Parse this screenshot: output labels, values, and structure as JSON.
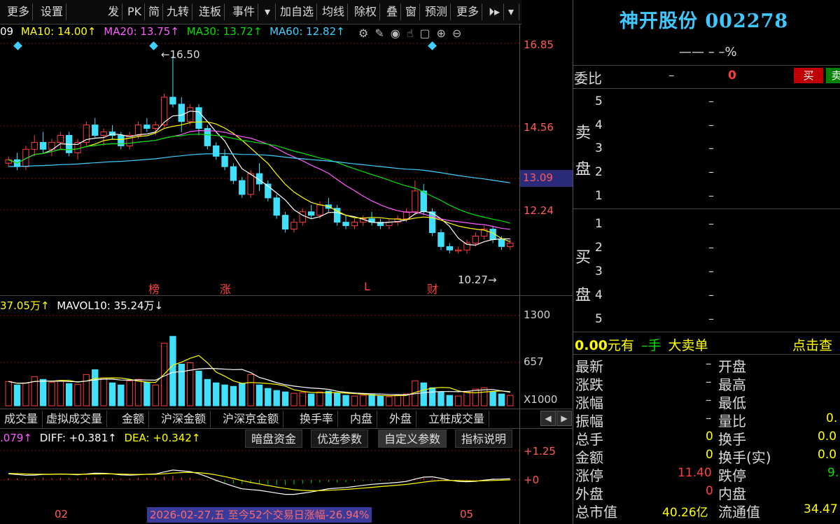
{
  "toolbar": {
    "items": [
      "更多",
      "设置",
      "发",
      "PK",
      "简",
      "九转",
      "连板",
      "事件",
      "▾",
      "加自选",
      "均线",
      "除权",
      "叠",
      "窗",
      "预测",
      "更多",
      "⏵▸",
      "▾"
    ]
  },
  "ma_legend": {
    "ma5": "09",
    "ma10": "MA10: 14.00↑",
    "ma20": "MA20: 13.75↑",
    "ma30": "MA30: 13.72↑",
    "ma60": "MA60: 12.82↑"
  },
  "colors": {
    "ma5": "#ffffff",
    "ma10": "#ffff00",
    "ma20": "#ff5cff",
    "ma30": "#00e000",
    "ma60": "#3fd0ff",
    "up": "#ff3c3c",
    "down": "#42e0ff",
    "axis_red": "#ff5a5a"
  },
  "price_axis": {
    "p1": "16.85",
    "p2": "14.56",
    "p3": "13.09",
    "p4": "12.24"
  },
  "annotations": {
    "high": "16.50",
    "low": "10.27",
    "mark1": "榜",
    "mark2": "涨",
    "mark3": "L",
    "mark4": "财"
  },
  "volume_legend": {
    "mavol5": "37.05万↑",
    "mavol10": "MAVOL10: 35.24万↓"
  },
  "volume_axis": {
    "v1": "1300",
    "v2": "657",
    "unit": "X1000"
  },
  "tabs": [
    "成交量",
    "虚拟成交量",
    "金额",
    "沪深金额",
    "沪深京金额",
    "换手率",
    "内盘",
    "外盘",
    "立桩成交量"
  ],
  "macd_legend": {
    "macd": ".079↑",
    "diff": "DIFF: +0.381↑",
    "dea": "DEA: +0.342↑"
  },
  "macd_buttons": [
    "暗盘资金",
    "优选参数",
    "自定义参数",
    "指标说明"
  ],
  "macd_axis": {
    "m1": "+1.25",
    "m2": "+0"
  },
  "date_axis": {
    "d1": "02",
    "d2": "05"
  },
  "status_tip": "2026-02-27,五 至今52个交易日涨幅-26.94%",
  "panel": {
    "title": "神开股份 002278",
    "change_line": "—— – –%",
    "weibi_label": "委比",
    "weibi_val": "–",
    "weibi_num": "0",
    "buy_btn": "买",
    "sell_btn": "卖",
    "sell_side_top": "卖",
    "sell_side_bottom": "盘",
    "buy_side_top": "买",
    "buy_side_bottom": "盘",
    "sell_levels": [
      "5",
      "4",
      "3",
      "2",
      "1"
    ],
    "buy_levels": [
      "1",
      "2",
      "3",
      "4",
      "5"
    ],
    "dash": "–",
    "bigorder_amount": "0.00",
    "bigorder_text1": "元有",
    "bigorder_text2": "–手",
    "bigorder_text3": "大卖单",
    "bigorder_link": "点击查"
  },
  "quotes": [
    {
      "label": "最新",
      "val": "–",
      "label2": "开盘",
      "val2": ""
    },
    {
      "label": "涨跌",
      "val": "–",
      "label2": "最高",
      "val2": ""
    },
    {
      "label": "涨幅",
      "val": "–",
      "label2": "最低",
      "val2": ""
    },
    {
      "label": "振幅",
      "val": "–",
      "label2": "量比",
      "val2": "0."
    },
    {
      "label": "总手",
      "val": "0",
      "label2": "换手",
      "val2": "0.0"
    },
    {
      "label": "金额",
      "val": "0",
      "label2": "换手(实)",
      "val2": "0.0"
    },
    {
      "label": "涨停",
      "val": "11.40",
      "label2": "跌停",
      "val2": "9."
    },
    {
      "label": "外盘",
      "val": "0",
      "label2": "内盘",
      "val2": ""
    },
    {
      "label": "总市值",
      "val": "40.26亿",
      "label2": "流通值",
      "val2": "34.47"
    }
  ],
  "candles": [
    [
      13.4,
      13.6,
      13.3,
      13.5
    ],
    [
      13.5,
      13.7,
      13.2,
      13.3
    ],
    [
      13.3,
      13.9,
      13.2,
      13.8
    ],
    [
      13.8,
      14.2,
      13.6,
      14.0
    ],
    [
      14.0,
      14.3,
      13.7,
      13.8
    ],
    [
      13.8,
      14.1,
      13.6,
      14.0
    ],
    [
      14.0,
      14.3,
      13.8,
      14.2
    ],
    [
      14.2,
      14.3,
      13.6,
      13.7
    ],
    [
      13.7,
      14.1,
      13.5,
      14.0
    ],
    [
      14.0,
      14.6,
      13.9,
      14.5
    ],
    [
      14.5,
      14.7,
      14.1,
      14.2
    ],
    [
      14.2,
      14.4,
      13.9,
      14.3
    ],
    [
      14.3,
      14.5,
      14.1,
      14.2
    ],
    [
      14.2,
      14.3,
      13.8,
      13.9
    ],
    [
      13.9,
      14.3,
      13.8,
      14.2
    ],
    [
      14.2,
      14.6,
      14.1,
      14.5
    ],
    [
      14.5,
      14.7,
      14.3,
      14.4
    ],
    [
      14.4,
      14.6,
      14.2,
      14.5
    ],
    [
      14.5,
      15.4,
      14.4,
      15.3
    ],
    [
      15.3,
      16.5,
      15.0,
      15.1
    ],
    [
      15.1,
      15.3,
      14.3,
      14.6
    ],
    [
      14.6,
      15.1,
      14.5,
      15.0
    ],
    [
      15.0,
      15.1,
      14.2,
      14.4
    ],
    [
      14.4,
      14.5,
      13.8,
      13.9
    ],
    [
      13.9,
      14.0,
      13.5,
      13.6
    ],
    [
      13.6,
      13.8,
      13.2,
      13.3
    ],
    [
      13.3,
      13.4,
      12.8,
      12.9
    ],
    [
      12.9,
      13.0,
      12.4,
      12.5
    ],
    [
      12.5,
      13.2,
      12.4,
      13.1
    ],
    [
      13.1,
      13.4,
      12.6,
      12.8
    ],
    [
      12.8,
      12.9,
      12.3,
      12.4
    ],
    [
      12.4,
      12.5,
      11.8,
      11.9
    ],
    [
      11.9,
      12.0,
      11.4,
      11.5
    ],
    [
      11.5,
      11.8,
      11.4,
      11.7
    ],
    [
      11.7,
      12.1,
      11.6,
      12.0
    ],
    [
      12.0,
      12.2,
      11.8,
      11.9
    ],
    [
      11.9,
      12.3,
      11.8,
      12.2
    ],
    [
      12.2,
      12.4,
      12.0,
      12.1
    ],
    [
      12.1,
      12.2,
      11.6,
      11.7
    ],
    [
      11.7,
      11.9,
      11.5,
      11.6
    ],
    [
      11.6,
      11.8,
      11.5,
      11.7
    ],
    [
      11.7,
      11.9,
      11.6,
      11.8
    ],
    [
      11.8,
      12.0,
      11.6,
      11.7
    ],
    [
      11.7,
      11.8,
      11.5,
      11.6
    ],
    [
      11.6,
      11.8,
      11.5,
      11.7
    ],
    [
      11.7,
      11.9,
      11.6,
      11.8
    ],
    [
      11.8,
      12.1,
      11.7,
      12.0
    ],
    [
      12.0,
      12.9,
      11.9,
      12.6
    ],
    [
      12.6,
      12.8,
      11.9,
      12.0
    ],
    [
      12.0,
      12.1,
      11.3,
      11.4
    ],
    [
      11.4,
      11.5,
      10.9,
      11.0
    ],
    [
      11.0,
      11.1,
      10.8,
      10.9
    ],
    [
      10.9,
      11.0,
      10.8,
      10.9
    ],
    [
      10.9,
      11.2,
      10.8,
      11.1
    ],
    [
      11.1,
      11.4,
      11.0,
      11.3
    ],
    [
      11.3,
      11.6,
      11.2,
      11.5
    ],
    [
      11.5,
      11.6,
      11.1,
      11.2
    ],
    [
      11.2,
      11.3,
      10.9,
      11.0
    ],
    [
      11.0,
      11.2,
      10.9,
      11.1
    ]
  ],
  "volumes": [
    350,
    300,
    330,
    420,
    380,
    340,
    360,
    320,
    310,
    450,
    520,
    400,
    330,
    300,
    360,
    380,
    340,
    300,
    900,
    1000,
    600,
    620,
    500,
    380,
    330,
    300,
    280,
    320,
    450,
    300,
    250,
    220,
    200,
    180,
    190,
    170,
    200,
    210,
    180,
    150,
    140,
    150,
    160,
    140,
    130,
    150,
    170,
    360,
    330,
    260,
    200,
    150,
    140,
    200,
    240,
    260,
    200,
    170,
    150
  ],
  "macd_hist": [
    0.15,
    0.12,
    0.1,
    0.14,
    0.18,
    0.16,
    0.18,
    0.14,
    0.12,
    0.2,
    0.22,
    0.18,
    0.14,
    0.1,
    0.12,
    0.16,
    0.18,
    0.18,
    0.3,
    0.35,
    0.22,
    0.2,
    0.08,
    -0.05,
    -0.15,
    -0.22,
    -0.3,
    -0.35,
    -0.3,
    -0.32,
    -0.38,
    -0.42,
    -0.45,
    -0.4,
    -0.32,
    -0.28,
    -0.22,
    -0.18,
    -0.2,
    -0.18,
    -0.14,
    -0.1,
    -0.08,
    -0.08,
    -0.06,
    -0.04,
    0.0,
    0.12,
    0.16,
    0.1,
    -0.02,
    -0.08,
    -0.1,
    -0.06,
    -0.02,
    0.04,
    0.06,
    0.03,
    0.05
  ]
}
